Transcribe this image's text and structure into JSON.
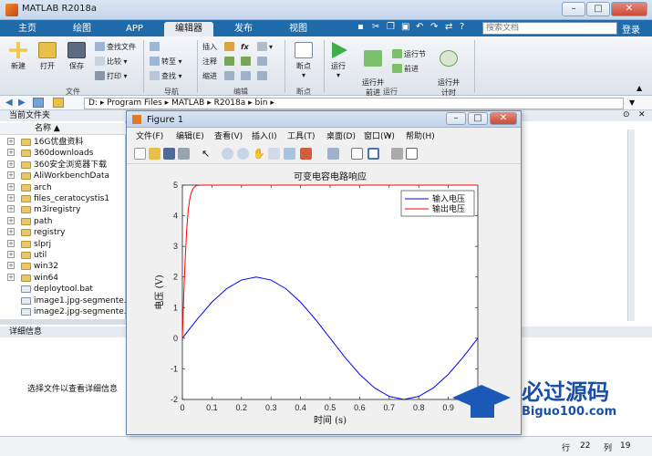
{
  "window": {
    "title": "MATLAB R2018a"
  },
  "tabs": [
    {
      "label": "主页",
      "active": false
    },
    {
      "label": "绘图",
      "active": false
    },
    {
      "label": "APP",
      "active": false
    },
    {
      "label": "编辑器",
      "active": true
    },
    {
      "label": "发布",
      "active": false
    },
    {
      "label": "视图",
      "active": false
    }
  ],
  "search": {
    "placeholder": "搜索文档"
  },
  "login": "登录",
  "ribbon": {
    "file": {
      "new": "新建",
      "open": "打开",
      "save": "保存",
      "find_files": "查找文件",
      "compare": "比较",
      "print": "打印",
      "group": "文件"
    },
    "navigate": {
      "go_to": "转至",
      "find": "查找",
      "group": "导航"
    },
    "edit": {
      "insert": "插入",
      "comment": "注释",
      "indent": "缩进",
      "fx": "fx",
      "group": "编辑"
    },
    "breakpoints": {
      "breakpoints": "断点",
      "group": "断点"
    },
    "run": {
      "run": "运行",
      "run_advance": "运行并\n前进",
      "run_section": "运行节",
      "advance": "前进",
      "run_time": "运行并\n计时",
      "group": "运行"
    }
  },
  "path": {
    "segments": [
      "D:",
      "Program Files",
      "MATLAB",
      "R2018a",
      "bin"
    ]
  },
  "current_folder": {
    "header": "当前文件夹",
    "name_col": "名称",
    "items": [
      {
        "name": "16G优盘资料",
        "type": "folder"
      },
      {
        "name": "360downloads",
        "type": "folder"
      },
      {
        "name": "360安全浏览器下载",
        "type": "folder"
      },
      {
        "name": "AliWorkbenchData",
        "type": "folder"
      },
      {
        "name": "arch",
        "type": "folder"
      },
      {
        "name": "files_ceratocystis1",
        "type": "folder"
      },
      {
        "name": "m3iregistry",
        "type": "folder"
      },
      {
        "name": "path",
        "type": "folder"
      },
      {
        "name": "registry",
        "type": "folder"
      },
      {
        "name": "slprj",
        "type": "folder"
      },
      {
        "name": "util",
        "type": "folder"
      },
      {
        "name": "win32",
        "type": "folder"
      },
      {
        "name": "win64",
        "type": "folder"
      },
      {
        "name": "deploytool.bat",
        "type": "file"
      },
      {
        "name": "image1.jpg-segmente...",
        "type": "file"
      },
      {
        "name": "image2.jpg-segmente...",
        "type": "file"
      }
    ]
  },
  "details": {
    "header": "详细信息",
    "text": "选择文件以查看详细信息"
  },
  "status": {
    "row_label": "行",
    "row": "22",
    "col_label": "列",
    "col": "19"
  },
  "figure": {
    "title": "Figure 1",
    "menu": [
      "文件(F)",
      "编辑(E)",
      "查看(V)",
      "插入(I)",
      "工具(T)",
      "桌面(D)",
      "窗口(W)",
      "帮助(H)"
    ]
  },
  "watermark": {
    "text": "必过源码",
    "domain": "Biguo100.com"
  },
  "chart_data": {
    "type": "line",
    "title": "可变电容电路响应",
    "xlabel": "时间 (s)",
    "ylabel": "电压 (V)",
    "xlim": [
      0,
      1
    ],
    "ylim": [
      -2,
      5
    ],
    "xticks": [
      "0",
      "0.1",
      "0.2",
      "0.3",
      "0.4",
      "0.5",
      "0.6",
      "0.7",
      "0.8",
      "0.9"
    ],
    "yticks": [
      "-2",
      "-1",
      "0",
      "1",
      "2",
      "3",
      "4",
      "5"
    ],
    "legend_position": "top-right",
    "series": [
      {
        "name": "输入电压",
        "color": "#0000ff",
        "x": [
          0,
          0.05,
          0.1,
          0.15,
          0.2,
          0.25,
          0.3,
          0.35,
          0.4,
          0.45,
          0.5,
          0.55,
          0.6,
          0.65,
          0.7,
          0.75,
          0.8,
          0.85,
          0.9,
          0.95,
          1.0
        ],
        "y": [
          0,
          0.62,
          1.18,
          1.62,
          1.9,
          2.0,
          1.9,
          1.62,
          1.18,
          0.62,
          0,
          -0.62,
          -1.18,
          -1.62,
          -1.9,
          -2.0,
          -1.9,
          -1.62,
          -1.18,
          -0.62,
          0
        ]
      },
      {
        "name": "输出电压",
        "color": "#ff0000",
        "x": [
          0,
          0.005,
          0.01,
          0.015,
          0.02,
          0.025,
          0.03,
          0.035,
          0.04,
          0.045,
          0.05,
          0.06,
          1.0
        ],
        "y": [
          0,
          1.5,
          2.7,
          3.6,
          4.2,
          4.55,
          4.75,
          4.87,
          4.93,
          4.97,
          4.99,
          5.0,
          5.0
        ]
      }
    ]
  }
}
